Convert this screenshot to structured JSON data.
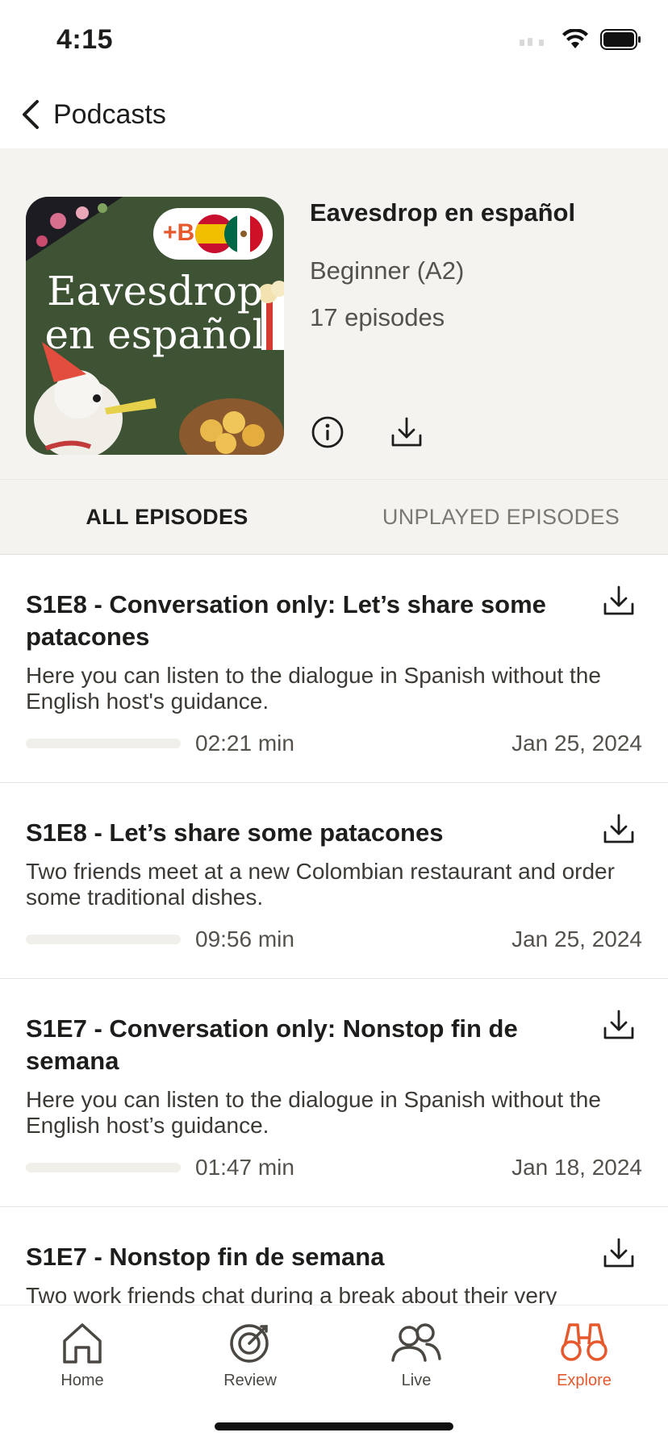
{
  "status_bar": {
    "time": "4:15"
  },
  "nav": {
    "back_label": "Podcasts"
  },
  "podcast": {
    "cover_title": "Eavesdrop en español",
    "badge_text": "+B",
    "title": "Eavesdrop en español",
    "level": "Beginner (A2)",
    "episode_count": "17 episodes"
  },
  "tabs": [
    {
      "label": "ALL EPISODES",
      "active": true
    },
    {
      "label": "UNPLAYED EPISODES",
      "active": false
    }
  ],
  "episodes": [
    {
      "title": "S1E8 - Conversation only: Let’s share some patacones",
      "description": "Here you can listen to the dialogue in Spanish without the English host's guidance.",
      "duration": "02:21 min",
      "date": "Jan 25, 2024",
      "progress": 0
    },
    {
      "title": "S1E8 - Let’s share some patacones",
      "description": "Two friends meet at a new Colombian restaurant and order some traditional dishes.",
      "duration": "09:56 min",
      "date": "Jan 25, 2024",
      "progress": 0
    },
    {
      "title": "S1E7 - Conversation only: Nonstop fin de semana",
      "description": "Here you can listen to the dialogue in Spanish without the English host’s guidance.",
      "duration": "01:47 min",
      "date": "Jan 18, 2024",
      "progress": 0
    },
    {
      "title": "S1E7 - Nonstop fin de semana",
      "description": "Two work friends chat during a break about their very",
      "duration": "",
      "date": "",
      "progress": 0
    }
  ],
  "tab_bar": {
    "items": [
      {
        "label": "Home",
        "icon": "home-icon",
        "active": false
      },
      {
        "label": "Review",
        "icon": "target-icon",
        "active": false
      },
      {
        "label": "Live",
        "icon": "people-icon",
        "active": false
      },
      {
        "label": "Explore",
        "icon": "binoculars-icon",
        "active": true
      }
    ]
  },
  "colors": {
    "accent": "#e5592d",
    "hero_background": "#f4f3f0",
    "cover_green": "#3e5234"
  }
}
